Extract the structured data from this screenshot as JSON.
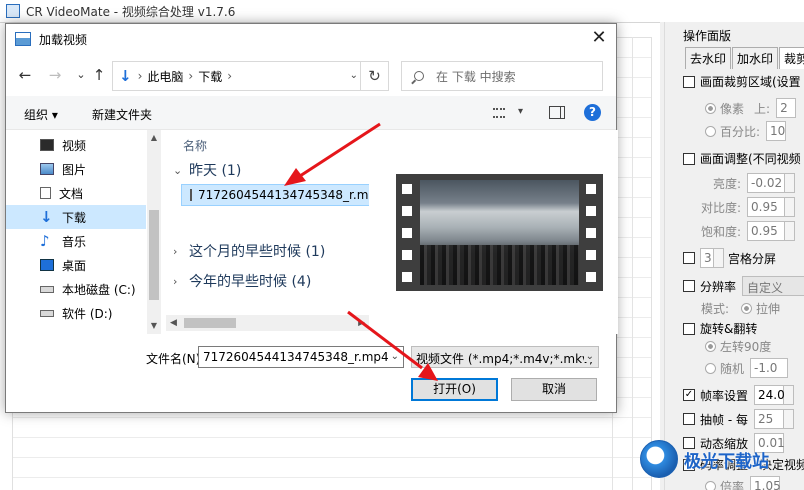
{
  "app": {
    "title": "CR VideoMate - 视频综合处理 v1.7.6"
  },
  "panel": {
    "title": "操作面版",
    "tabs": [
      "去水印",
      "加水印",
      "裁剪"
    ],
    "crop_region": "画面裁剪区域(设置",
    "unit_pixel": "像素",
    "label_top": "上:",
    "top_value": "2",
    "unit_percent": "百分比:",
    "percent_value": "10",
    "adjust": "画面调整(不同视频",
    "brightness_label": "亮度:",
    "brightness_value": "-0.02",
    "contrast_label": "对比度:",
    "contrast_value": "0.95",
    "saturation_label": "饱和度:",
    "saturation_value": "0.95",
    "grid_value": "3",
    "grid_label": "宫格分屏",
    "resolution_label": "分辨率",
    "resolution_value": "自定义",
    "mode_label": "模式:",
    "mode_value": "拉伸",
    "rotate_label": "旋转&翻转",
    "rotate_left": "左转90度",
    "random_label": "随机",
    "random_value": "-1.0",
    "framerate_label": "帧率设置",
    "framerate_value": "24.0",
    "skip_label": "抽帧 - 每",
    "skip_value": "25",
    "zoom_label": "动态缩放",
    "zoom_value": "0.01",
    "bitrate_label": "码率调整 - 决定视频",
    "bitrate_unit": "倍率",
    "bitrate_value": "1.05"
  },
  "dialog": {
    "title": "加载视频",
    "close": "✕",
    "nav": {
      "back": "←",
      "forward": "→",
      "dropdown": "⌄",
      "up": "↑"
    },
    "address": {
      "root": "此电脑",
      "current": "下载",
      "sep": "›",
      "refresh": "↻"
    },
    "search_placeholder": "在 下载 中搜索",
    "toolbar": {
      "organize": "组织 ▾",
      "new_folder": "新建文件夹",
      "view_dd": "▾",
      "help": "?"
    },
    "sidebar": [
      {
        "label": "视频",
        "icon": "video-icon"
      },
      {
        "label": "图片",
        "icon": "picture-icon"
      },
      {
        "label": "文档",
        "icon": "document-icon"
      },
      {
        "label": "下载",
        "icon": "download-icon"
      },
      {
        "label": "音乐",
        "icon": "music-icon"
      },
      {
        "label": "桌面",
        "icon": "desktop-icon"
      },
      {
        "label": "本地磁盘 (C:)",
        "icon": "drive-icon"
      },
      {
        "label": "软件 (D:)",
        "icon": "drive-icon"
      }
    ],
    "column_header": "名称",
    "groups": [
      {
        "label": "昨天 (1)",
        "chev": "⌄"
      },
      {
        "label": "这个月的早些时候 (1)",
        "chev": "›"
      },
      {
        "label": "今年的早些时候 (4)",
        "chev": "›"
      }
    ],
    "file_name": "7172604544134745348_r.mp4",
    "filename_label": "文件名(N):",
    "filename_value": "7172604544134745348_r.mp4",
    "filter_value": "视频文件 (*.mp4;*.m4v;*.mkv;",
    "open_button": "打开(O)",
    "cancel_button": "取消"
  },
  "watermark": "极光下载站",
  "colors": {
    "selection": "#cce8ff",
    "accent": "#0078d7",
    "arrow": "#e5161b"
  }
}
